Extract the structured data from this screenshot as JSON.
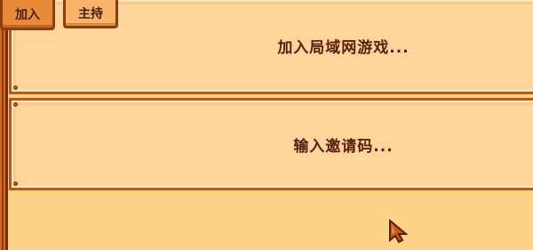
{
  "tabs": [
    {
      "label": "加入",
      "active": true
    },
    {
      "label": "主持",
      "active": false
    }
  ],
  "options": {
    "lan_label": "加入局域网游戏...",
    "invite_label": "输入邀请码..."
  },
  "colors": {
    "background": "#ffd07a",
    "panel": "#ffd59b",
    "border": "#b35a22",
    "frame": "#d66a1b",
    "active_tab": "#e98a3a",
    "inactive_tab": "#f8b46a",
    "text": "#5a1e0c"
  },
  "cursor_icon": "pointer-arrow-icon"
}
